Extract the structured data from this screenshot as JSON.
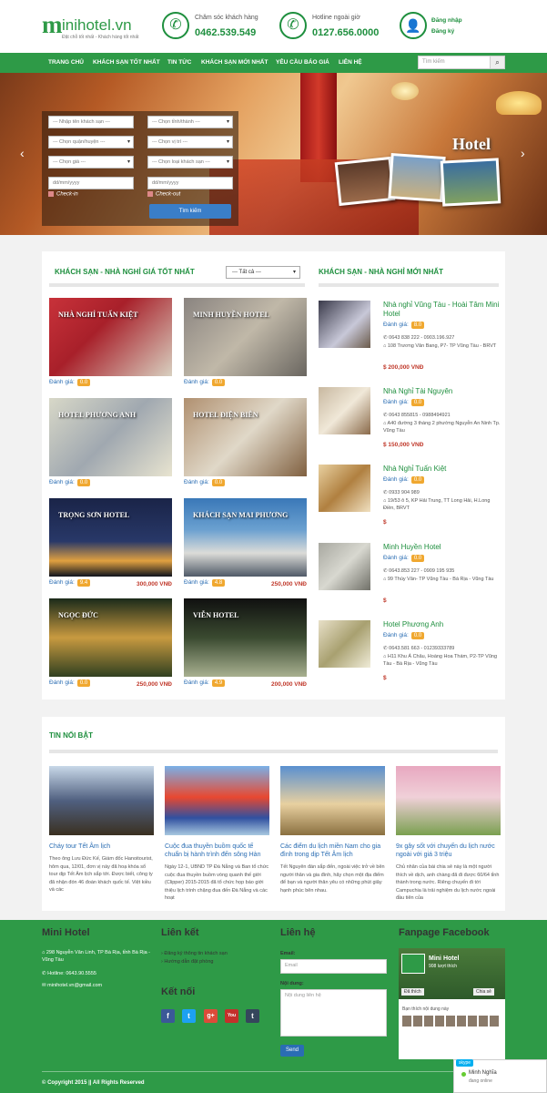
{
  "header": {
    "logo_big": "m",
    "logo_rest": "inihotel.vn",
    "logo_tagline": "Đặt chỗ tốt nhất - Khách hàng tốt nhất",
    "care_label": "Chăm sóc khách hàng",
    "care_phone": "0462.539.549",
    "hotline_label": "Hotline ngoài giờ",
    "hotline_phone": "0127.656.0000",
    "login": "Đăng nhập",
    "register": "Đăng ký"
  },
  "nav": {
    "items": [
      "TRANG CHỦ",
      "KHÁCH SẠN TỐT NHẤT",
      "TIN TỨC",
      "KHÁCH SẠN MỚI NHẤT",
      "YÊU CẦU BÁO GIÁ",
      "LIÊN HỆ"
    ],
    "search_placeholder": "Tìm kiếm"
  },
  "banner": {
    "sign": "Hotel",
    "form": {
      "hotel_name": "--- Nhập tên khách sạn ---",
      "province": "--- Chọn tỉnh/thành ---",
      "district": "--- Chọn quận/huyện ---",
      "location": "--- Chọn vị trí ---",
      "price": "--- Chọn giá ---",
      "hotel_type": "--- Chọn loại khách sạn ---",
      "date_in": "dd/mm/yyyy",
      "date_out": "dd/mm/yyyy",
      "checkin": "Check-in",
      "checkout": "Check-out",
      "submit": "Tìm kiếm"
    }
  },
  "best": {
    "title": "KHÁCH SẠN - NHÀ NGHỈ GIÁ TỐT NHẤT",
    "filter": "--- Tất cả ---",
    "rating_label": "Đánh giá:",
    "hotels": [
      {
        "name": "NHÀ NGHỈ TUẤN KIỆT",
        "rating": "0.0",
        "price": ""
      },
      {
        "name": "MINH HUYỀN HOTEL",
        "rating": "0.0",
        "price": ""
      },
      {
        "name": "HOTEL PHƯƠNG ANH",
        "rating": "0.0",
        "price": ""
      },
      {
        "name": "HOTEL ĐIỆN BIÊN",
        "rating": "0.0",
        "price": ""
      },
      {
        "name": "TRỌNG SƠN HOTEL",
        "rating": "9.4",
        "price": "300,000 VNĐ"
      },
      {
        "name": "KHÁCH SẠN MAI PHƯƠNG",
        "rating": "4.8",
        "price": "250,000 VNĐ"
      },
      {
        "name": "NGỌC ĐỨC",
        "rating": "0.0",
        "price": "250,000 VNĐ"
      },
      {
        "name": "VIỄN HOTEL",
        "rating": "4.9",
        "price": "200,000 VNĐ"
      }
    ]
  },
  "newest": {
    "title": "KHÁCH SẠN - NHÀ NGHỈ MỚI NHẤT",
    "rating_label": "Đánh giá:",
    "hotels": [
      {
        "name": "Nhà nghỉ Vũng Tàu - Hoài Tâm Mini Hotel",
        "rating": "8.0",
        "phone": "0643 838 222 - 0903.196.927",
        "address": "108 Trương Văn Bang, P7- TP Vũng Tàu - BRVT",
        "price": "200,000 VNĐ"
      },
      {
        "name": "Nhà Nghỉ Tài Nguyên",
        "rating": "0.0",
        "phone": "0643 855815 - 0988494921",
        "address": "A40 đường 3 tháng 2 phường Nguyễn An Ninh Tp. Vũng Tàu",
        "price": "150,000 VNĐ"
      },
      {
        "name": "Nhà Nghỉ Tuấn Kiệt",
        "rating": "0.0",
        "phone": "0933 904 989",
        "address": "19/53 ô 5, KP Hải Trung, TT Long Hải, H.Long Điền, BRVT",
        "price": ""
      },
      {
        "name": "Minh Huyền Hotel",
        "rating": "0.0",
        "phone": "0643.853 227 - 0909 195 935",
        "address": "99 Thùy Vân- TP Vũng Tàu - Bà Rịa - Vũng Tàu",
        "price": ""
      },
      {
        "name": "Hotel Phương Anh",
        "rating": "0.0",
        "phone": "0643.581 663 - 01239333789",
        "address": "H11 Khu Á Châu, Hoàng Hoa Thám, P2-TP Vũng Tàu - Bà Rịa - Vũng Tàu",
        "price": ""
      }
    ]
  },
  "news": {
    "title": "TIN NỔI BẬT",
    "items": [
      {
        "title": "Cháy tour Tết Âm lịch",
        "desc": "Theo ông Lưu Đức Kế, Giám đốc Hanoitourist, hôm qua, 12/01, đơn vị này đã hoạ khóa sổ tour dịp Tết Âm lịch sắp tới. Được biết, công ty đã nhận đón 46 đoàn khách quốc tế. Việt kiều và các"
      },
      {
        "title": "Cuộc đua thuyền buồm quốc tế chuẩn bị hành trình đến sông Hàn",
        "desc": "Ngày 12-1, UBND TP Đà Nẵng và Ban tổ chức cuộc đua thuyền buồm vòng quanh thế giới (Clipper) 2015-2015 đã tổ chức họp báo giới thiệu lịch trình chặng đua đến Đà Nẵng và các hoạt"
      },
      {
        "title": "Các điểm du lịch miền Nam cho gia đình trong dịp Tết Âm lịch",
        "desc": "Tết Nguyên đán sắp đến, ngoài việc trở về bên người thân và gia đình, hãy chọn một địa điểm để bạn và người thân yêu có những phút giây hạnh phúc bên nhau."
      },
      {
        "title": "9x gây sốt với chuyến du lịch nước ngoài với giá 3 triệu",
        "desc": "Chủ nhân của bài chia sẻ này là một người thích về dịch, anh chàng đã đi được 60/64 tỉnh thành trong nước. Riêng chuyến đi tới Campuchia là trải nghiệm du lịch nước ngoài đầu tiên của"
      }
    ]
  },
  "footer": {
    "about_title": "Mini Hotel",
    "address": "298 Nguyễn Văn Linh, TP Bà Rịa, tỉnh Bà Rịa - Vũng Tàu",
    "hotline": "Hotline: 0643.90.5555",
    "email": "minihotel.vn@gmail.com",
    "links_title": "Liên kết",
    "links": [
      "Đăng ký thông tin khách sạn",
      "Hướng dẫn đặt phòng"
    ],
    "connect_title": "Kết nối",
    "contact_title": "Liên hệ",
    "email_label": "Email:",
    "email_placeholder": "Email",
    "content_label": "Nội dung:",
    "content_placeholder": "Nội dung liên hệ",
    "send": "Send",
    "fb_title": "Fanpage Facebook",
    "fb_name": "Mini Hotel",
    "fb_likes": "908 lượt thích",
    "fb_like_btn": "Đã thích",
    "fb_share": "Chia sẻ",
    "fb_friends": "Bạn thích nội dung này",
    "copyright": "© Copyright 2015 || All Rights Reserved",
    "skype_name": "Minh Nghĩa",
    "skype_status": "đang online"
  },
  "colors": {
    "brand_green": "#2e9a47",
    "link_blue": "#2a6db3",
    "price_red": "#c0392b",
    "badge": "#f0a830"
  }
}
